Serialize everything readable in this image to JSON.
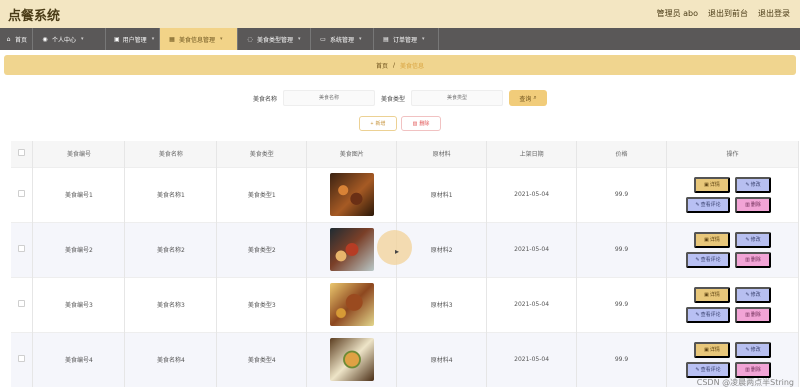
{
  "app": {
    "title": "点餐系统",
    "admin_label": "管理员 abo",
    "frontend_label": "退出到前台",
    "logout_label": "退出登录"
  },
  "nav": [
    {
      "label": "首页",
      "icon": "home-icon",
      "active": false
    },
    {
      "label": "个人中心",
      "icon": "user-icon",
      "active": false
    },
    {
      "label": "用户管理",
      "icon": "users-icon",
      "active": false
    },
    {
      "label": "美食信息管理",
      "icon": "grid-icon",
      "active": true
    },
    {
      "label": "美食类型管理",
      "icon": "tag-icon",
      "active": false
    },
    {
      "label": "系统管理",
      "icon": "monitor-icon",
      "active": false
    },
    {
      "label": "订单管理",
      "icon": "clipboard-icon",
      "active": false
    }
  ],
  "breadcrumb": {
    "home": "首页",
    "separator": "/",
    "current": "美食信息"
  },
  "search": {
    "name_label": "美食名称",
    "name_placeholder": "美食名称",
    "type_label": "美食类型",
    "type_placeholder": "美食类型",
    "button": "查询"
  },
  "actions": {
    "add": "新增",
    "delete": "删除"
  },
  "table": {
    "headers": [
      "",
      "美食编号",
      "美食名称",
      "美食类型",
      "美食图片",
      "原材料",
      "上架日期",
      "价格",
      "操作"
    ],
    "rows": [
      {
        "id": "美食编号1",
        "name": "美食名称1",
        "type": "美食类型1",
        "material": "原材料1",
        "date": "2021-05-04",
        "price": "99.9",
        "image": "food1"
      },
      {
        "id": "美食编号2",
        "name": "美食名称2",
        "type": "美食类型2",
        "material": "原材料2",
        "date": "2021-05-04",
        "price": "99.9",
        "image": "food2"
      },
      {
        "id": "美食编号3",
        "name": "美食名称3",
        "type": "美食类型3",
        "material": "原材料3",
        "date": "2021-05-04",
        "price": "99.9",
        "image": "food3"
      },
      {
        "id": "美食编号4",
        "name": "美食名称4",
        "type": "美食类型4",
        "material": "原材料4",
        "date": "2021-05-04",
        "price": "99.9",
        "image": "food4"
      }
    ],
    "row_actions": {
      "detail": "详情",
      "edit": "修改",
      "review": "查看评论",
      "remove": "删除"
    }
  },
  "watermark": "CSDN @凌晨两点半String",
  "colors": {
    "topbar": "#f3e6c2",
    "nav_bg": "#5a5858",
    "nav_active": "#f2d388",
    "detail": "#e8c77a",
    "edit": "#b7bff0",
    "remove": "#f2a4d6"
  }
}
